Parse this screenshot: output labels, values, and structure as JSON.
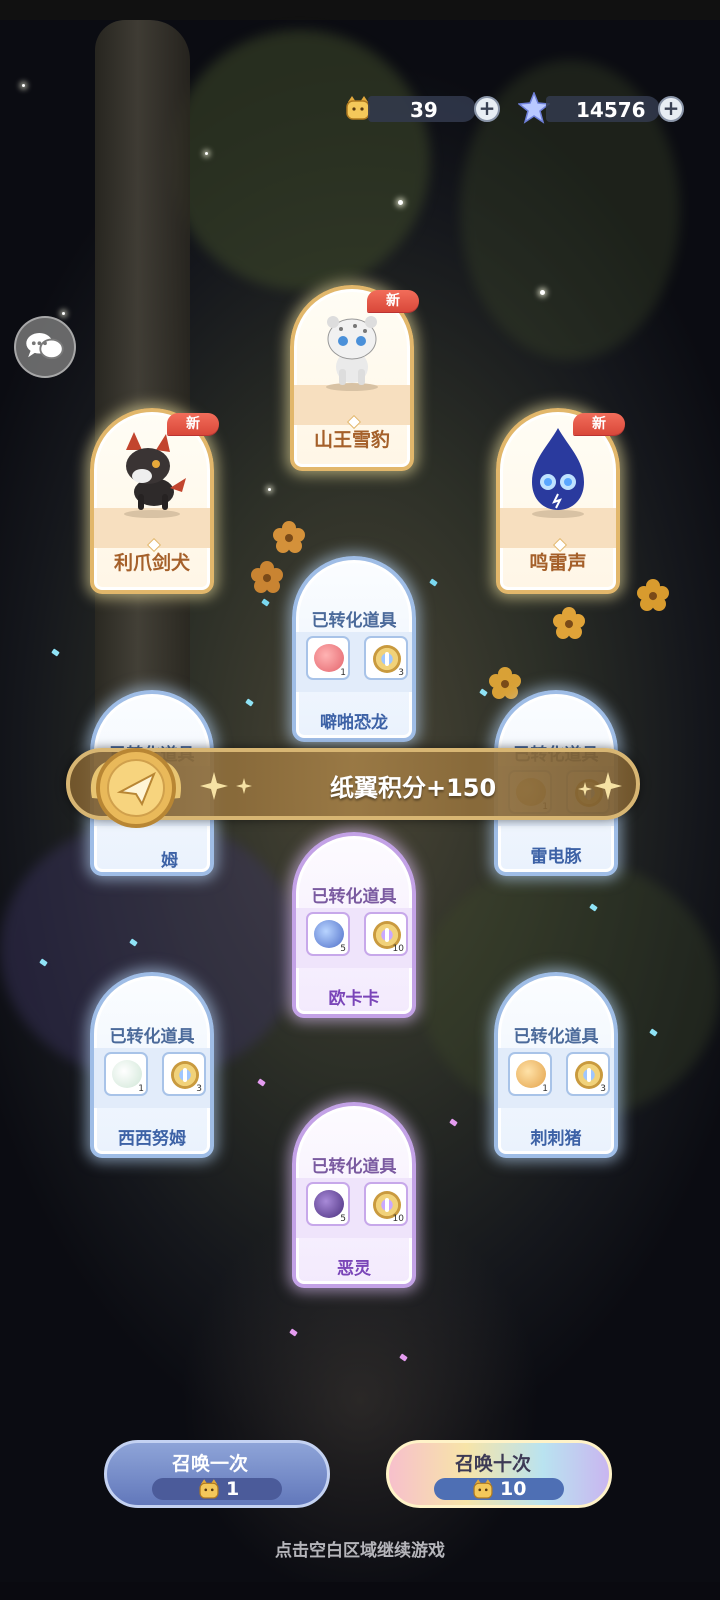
{
  "currency": {
    "tickets": "39",
    "stars": "14576",
    "plus": "+"
  },
  "chat": {
    "icon": "chat-bubbles-icon"
  },
  "new_cards": [
    {
      "name": "山王雪豹",
      "badge": "新"
    },
    {
      "name": "利爪剑犬",
      "badge": "新"
    },
    {
      "name": "鸣雷声",
      "badge": "新"
    }
  ],
  "converted_cards": [
    {
      "header": "已转化道具",
      "name": "噼啪恐龙",
      "item_count": "1",
      "token_count": "3"
    },
    {
      "header": "已转化道具",
      "name": "西西努姆",
      "item_count": "",
      "token_count": ""
    },
    {
      "header": "已转化道具",
      "name": "雷电豚",
      "item_count": "1",
      "token_count": ""
    },
    {
      "header": "已转化道具",
      "name": "欧卡卡",
      "item_count": "5",
      "token_count": "10"
    },
    {
      "header": "已转化道具",
      "name": "西西努姆",
      "item_count": "1",
      "token_count": "3"
    },
    {
      "header": "已转化道具",
      "name": "刺刺猪",
      "item_count": "1",
      "token_count": "3"
    },
    {
      "header": "已转化道具",
      "name": "恶灵",
      "item_count": "5",
      "token_count": "10"
    }
  ],
  "banner": {
    "text": "纸翼积分+150",
    "partial_name": "姆"
  },
  "buttons": {
    "summon_one": {
      "label": "召唤一次",
      "cost": "1"
    },
    "summon_ten": {
      "label": "召唤十次",
      "cost": "10"
    }
  },
  "hint": "点击空白区域继续游戏"
}
